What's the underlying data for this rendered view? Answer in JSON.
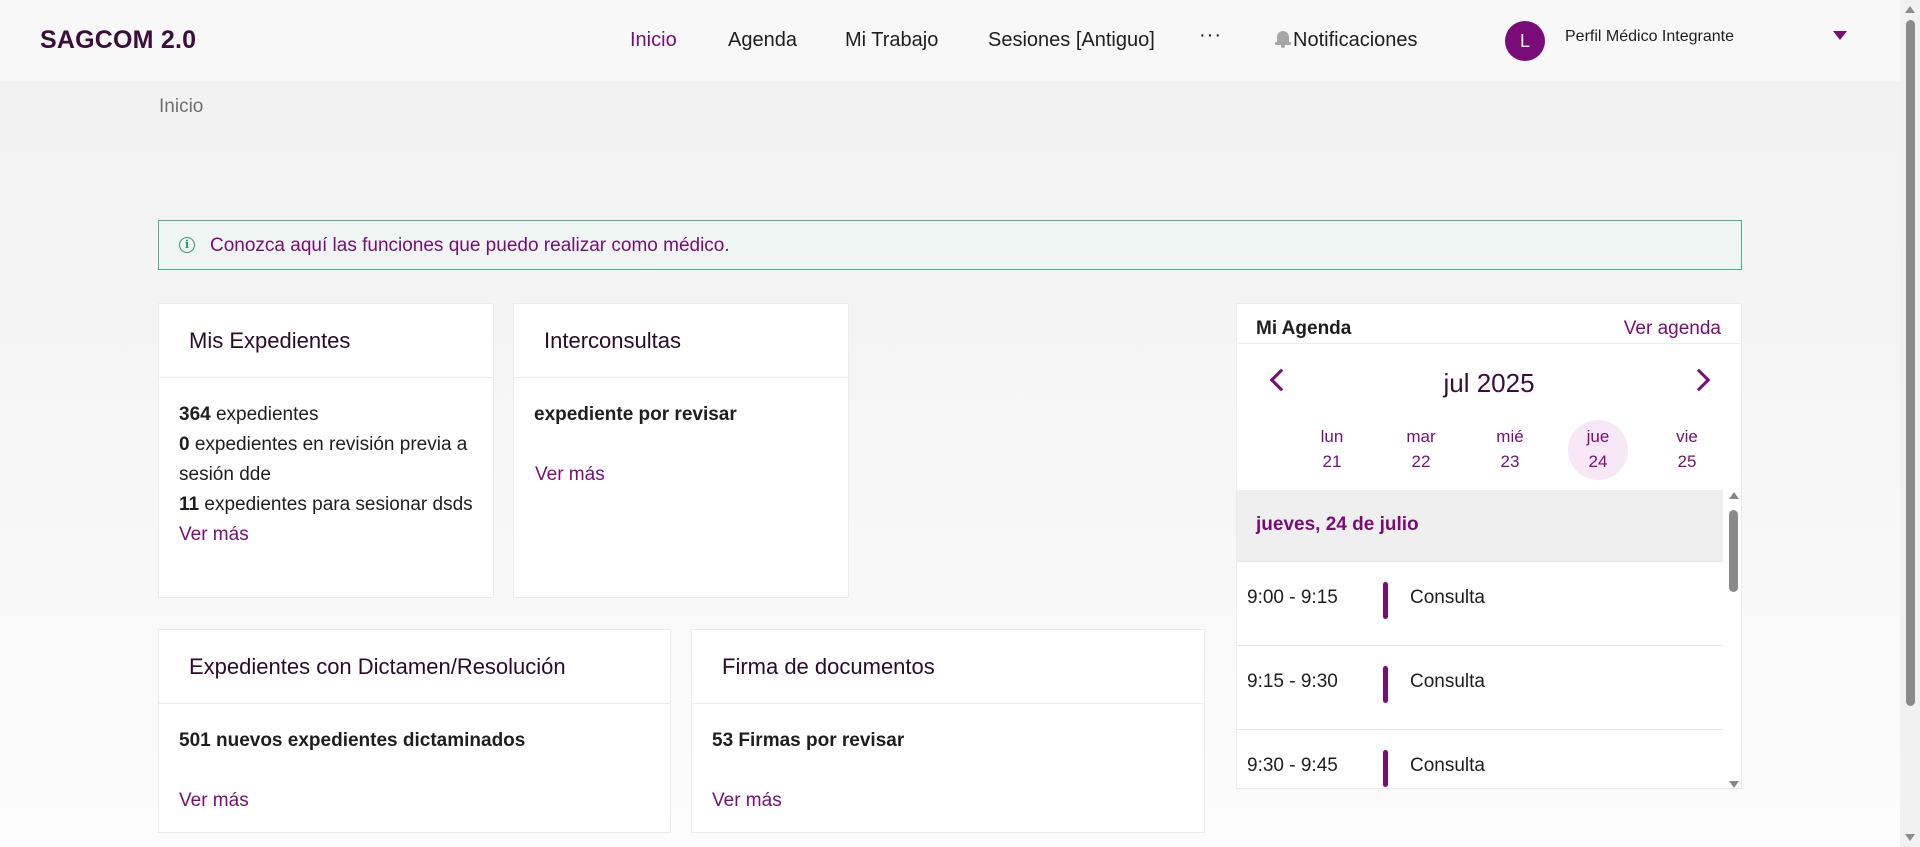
{
  "header": {
    "brand": "SAGCOM 2.0",
    "nav": [
      "Inicio",
      "Agenda",
      "Mi Trabajo",
      "Sesiones [Antiguo]"
    ],
    "more": "···",
    "notifications": "Notificaciones",
    "avatar_initial": "L",
    "profile_name": "Perfil Médico Integrante"
  },
  "breadcrumb": "Inicio",
  "alert": {
    "text": "Conozca aquí las funciones que puedo realizar como médico."
  },
  "cards": {
    "expedientes": {
      "title": "Mis Expedientes",
      "count_total": "364",
      "label_total": "expedientes",
      "count_revision": "0",
      "label_revision": "expedientes en revisión previa a sesión dde",
      "count_sesionar": "11",
      "label_sesionar": "expedientes para sesionar dsds",
      "link": "Ver más"
    },
    "interconsultas": {
      "title": "Interconsultas",
      "text": "expediente por revisar",
      "link": "Ver más"
    },
    "dictamen": {
      "title": "Expedientes con Dictamen/Resolución",
      "text": "501 nuevos expedientes dictaminados",
      "link": "Ver más"
    },
    "firma": {
      "title": "Firma de documentos",
      "text": "53 Firmas por revisar",
      "link": "Ver más"
    }
  },
  "agenda": {
    "title": "Mi Agenda",
    "link": "Ver agenda",
    "month": "jul 2025",
    "days": [
      {
        "name": "lun",
        "num": "21"
      },
      {
        "name": "mar",
        "num": "22"
      },
      {
        "name": "mié",
        "num": "23"
      },
      {
        "name": "jue",
        "num": "24"
      },
      {
        "name": "vie",
        "num": "25"
      }
    ],
    "selected_date": "jueves, 24 de julio",
    "events": [
      {
        "time": "9:00 - 9:15",
        "name": "Consulta"
      },
      {
        "time": "9:15 - 9:30",
        "name": "Consulta"
      },
      {
        "time": "9:30 - 9:45",
        "name": "Consulta"
      }
    ]
  },
  "colors": {
    "accent": "#7a0c7a",
    "alert_border": "#4fb08c",
    "alert_bg": "#eef5f2"
  }
}
